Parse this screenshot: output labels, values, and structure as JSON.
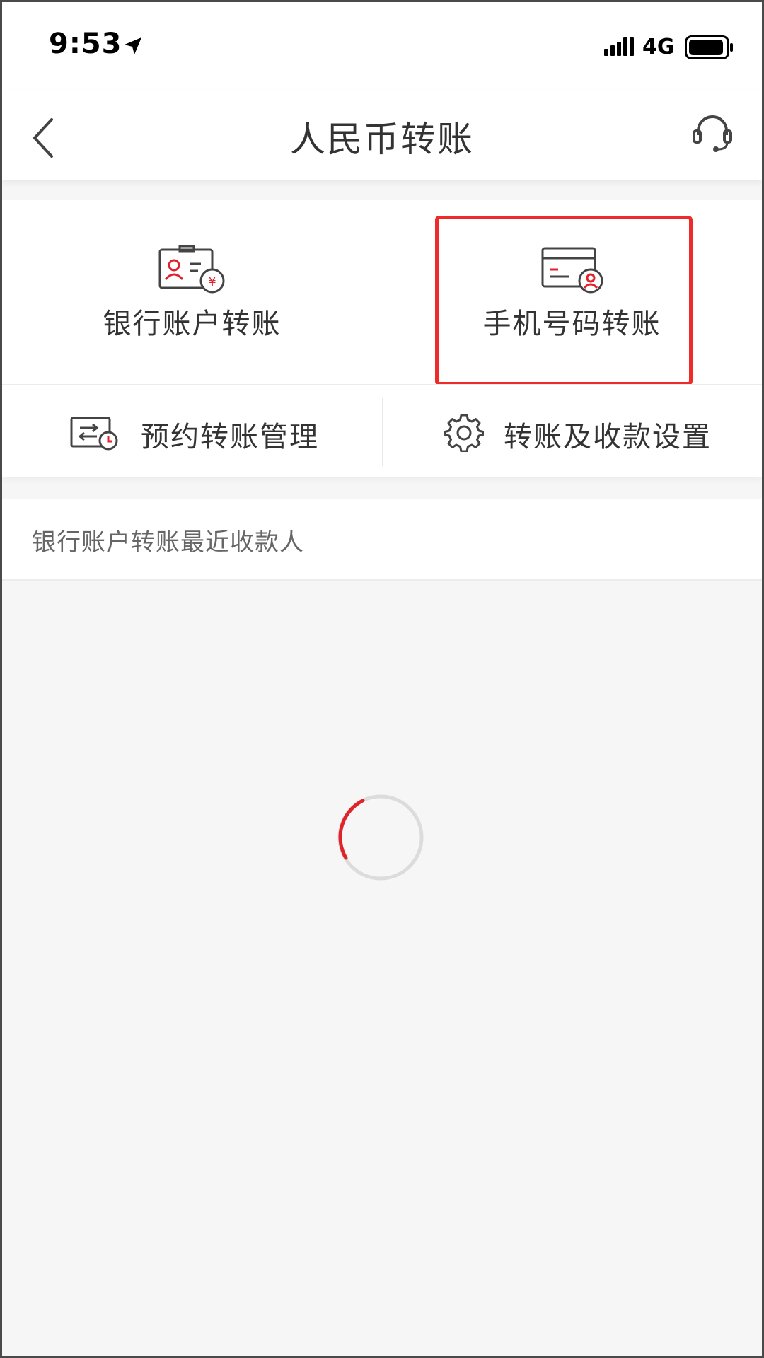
{
  "status_bar": {
    "time": "9:53",
    "network": "4G"
  },
  "nav": {
    "title": "人民币转账"
  },
  "options": [
    {
      "label": "银行账户转账",
      "icon": "bank-account-card-icon"
    },
    {
      "label": "手机号码转账",
      "icon": "phone-number-card-icon"
    }
  ],
  "secondary": [
    {
      "label": "预约转账管理",
      "icon": "scheduled-transfer-icon"
    },
    {
      "label": "转账及收款设置",
      "icon": "gear-icon"
    }
  ],
  "recent": {
    "title": "银行账户转账最近收款人"
  },
  "colors": {
    "accent": "#e0232b",
    "highlight": "#ee2a2a",
    "text": "#333333",
    "muted": "#666666"
  }
}
